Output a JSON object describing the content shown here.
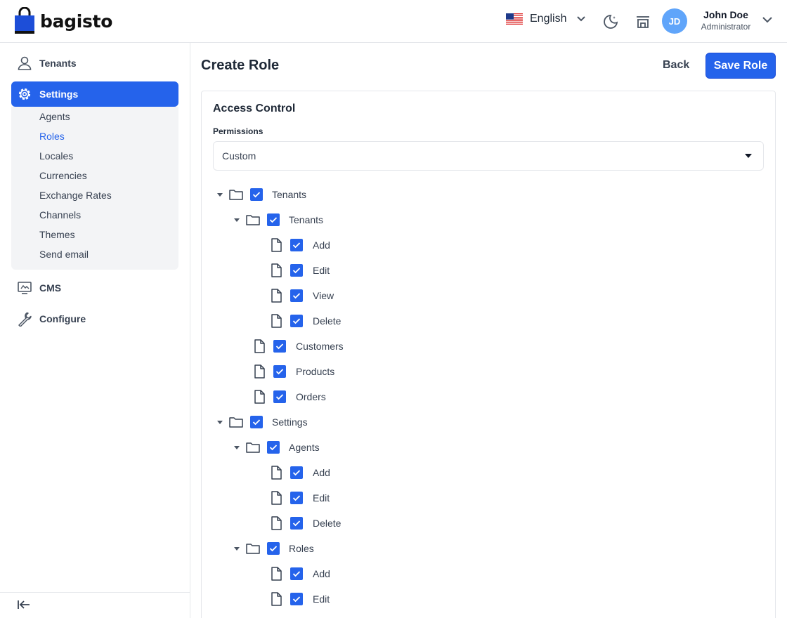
{
  "header": {
    "logo_text": "bagisto",
    "language": "English",
    "user": {
      "initials": "JD",
      "name": "John Doe",
      "role": "Administrator"
    }
  },
  "sidebar": {
    "items": [
      {
        "label": "Tenants",
        "icon": "user-icon"
      },
      {
        "label": "Settings",
        "icon": "gear-icon"
      },
      {
        "label": "CMS",
        "icon": "monitor-icon"
      },
      {
        "label": "Configure",
        "icon": "wrench-icon"
      }
    ],
    "settings_submenu": [
      {
        "label": "Agents"
      },
      {
        "label": "Roles"
      },
      {
        "label": "Locales"
      },
      {
        "label": "Currencies"
      },
      {
        "label": "Exchange Rates"
      },
      {
        "label": "Channels"
      },
      {
        "label": "Themes"
      },
      {
        "label": "Send email"
      }
    ]
  },
  "page": {
    "title": "Create Role",
    "back_label": "Back",
    "save_label": "Save Role"
  },
  "access_control": {
    "title": "Access Control",
    "permissions_label": "Permissions",
    "permissions_value": "Custom",
    "tree": [
      {
        "label": "Tenants",
        "type": "folder",
        "level": 0,
        "checked": true
      },
      {
        "label": "Tenants",
        "type": "folder",
        "level": 1,
        "checked": true
      },
      {
        "label": "Add",
        "type": "file",
        "level": 2,
        "checked": true
      },
      {
        "label": "Edit",
        "type": "file",
        "level": 2,
        "checked": true
      },
      {
        "label": "View",
        "type": "file",
        "level": 2,
        "checked": true
      },
      {
        "label": "Delete",
        "type": "file",
        "level": 2,
        "checked": true
      },
      {
        "label": "Customers",
        "type": "file",
        "level": 1,
        "checked": true
      },
      {
        "label": "Products",
        "type": "file",
        "level": 1,
        "checked": true
      },
      {
        "label": "Orders",
        "type": "file",
        "level": 1,
        "checked": true
      },
      {
        "label": "Settings",
        "type": "folder",
        "level": 0,
        "checked": true
      },
      {
        "label": "Agents",
        "type": "folder",
        "level": 1,
        "checked": true
      },
      {
        "label": "Add",
        "type": "file",
        "level": 2,
        "checked": true
      },
      {
        "label": "Edit",
        "type": "file",
        "level": 2,
        "checked": true
      },
      {
        "label": "Delete",
        "type": "file",
        "level": 2,
        "checked": true
      },
      {
        "label": "Roles",
        "type": "folder",
        "level": 1,
        "checked": true
      },
      {
        "label": "Add",
        "type": "file",
        "level": 2,
        "checked": true
      },
      {
        "label": "Edit",
        "type": "file",
        "level": 2,
        "checked": true
      }
    ]
  },
  "colors": {
    "accent": "#2563eb",
    "avatar": "#60a5fa",
    "submenu_bg": "#f3f4f6"
  }
}
